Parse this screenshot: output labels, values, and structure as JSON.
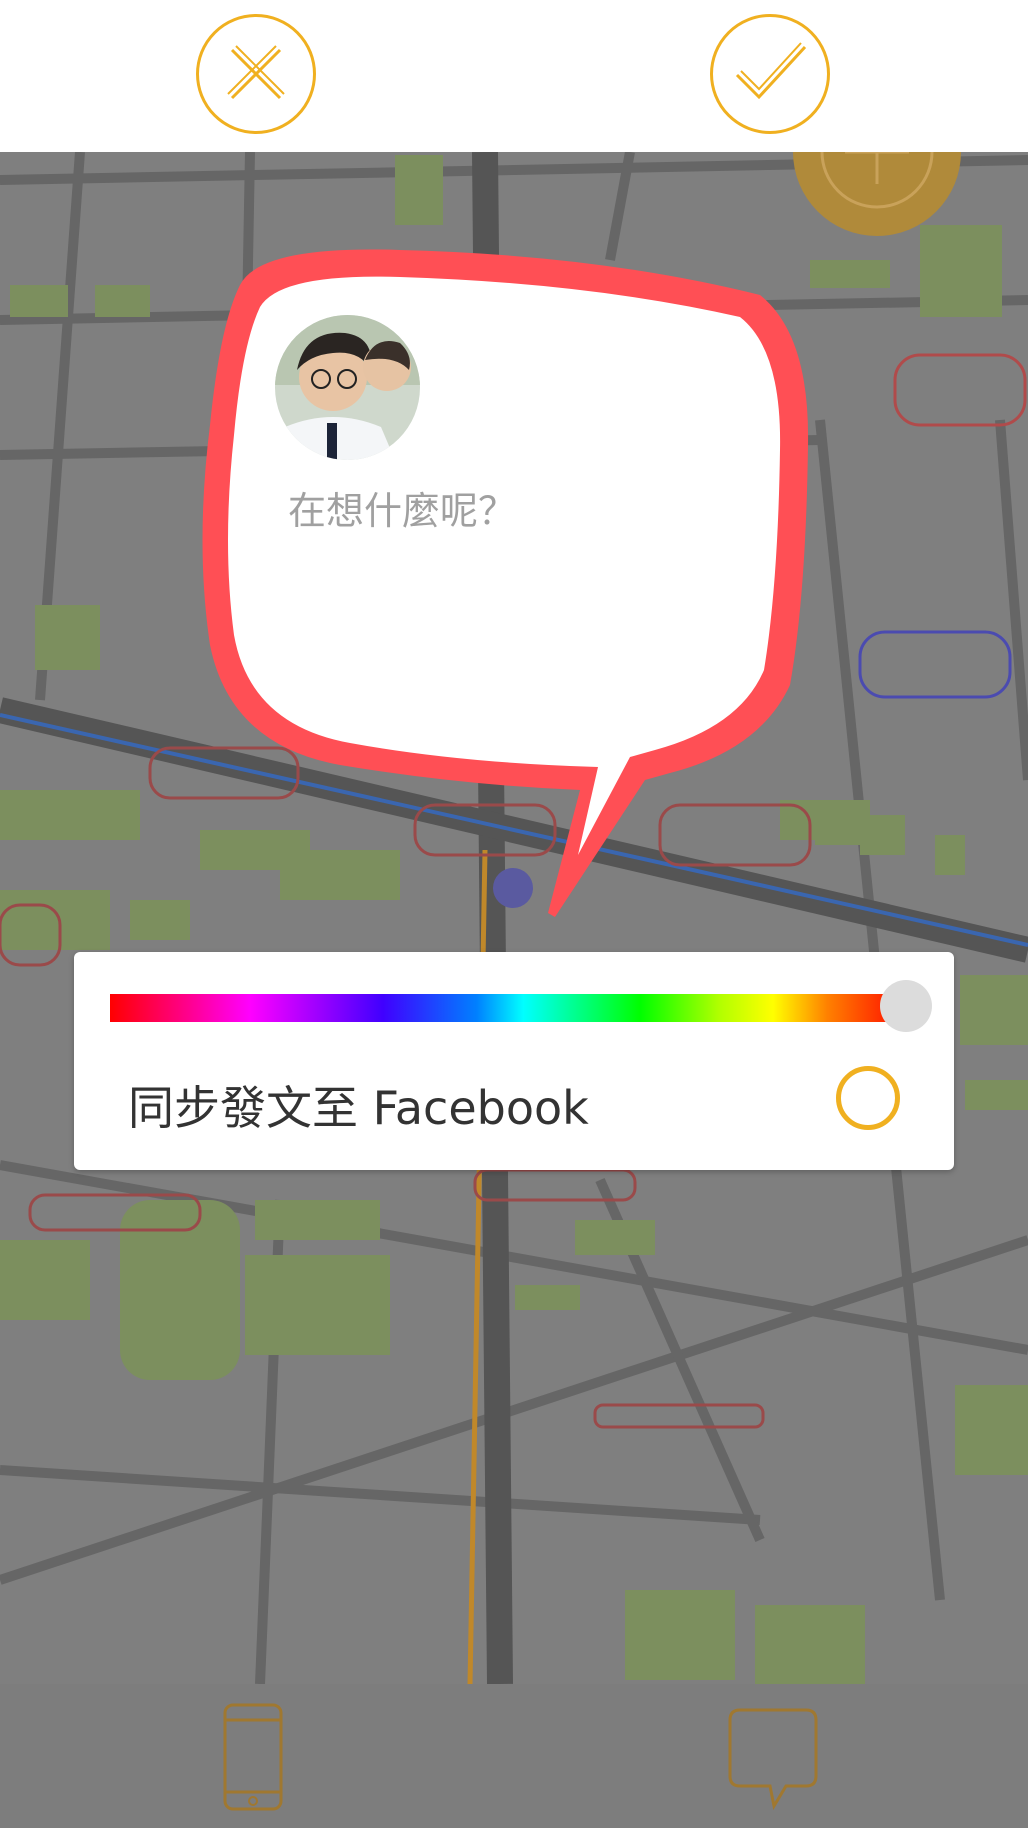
{
  "topbar": {
    "cancel_icon": "close-icon",
    "confirm_icon": "checkmark-icon",
    "accent_color": "#f0b020"
  },
  "map": {
    "background_color": "#7f7f7f",
    "building_color": "#7c8f5e",
    "add_icon": "plus-icon"
  },
  "post": {
    "bubble_color": "#ff4f55",
    "avatar_icon": "user-avatar",
    "placeholder": "在想什麼呢？"
  },
  "options": {
    "hue_selected": "red",
    "sync_label": "同步發文至 Facebook",
    "sync_enabled": false
  },
  "bottombar": {
    "left_icon": "phone-icon",
    "right_icon": "speech-bubble-icon"
  }
}
